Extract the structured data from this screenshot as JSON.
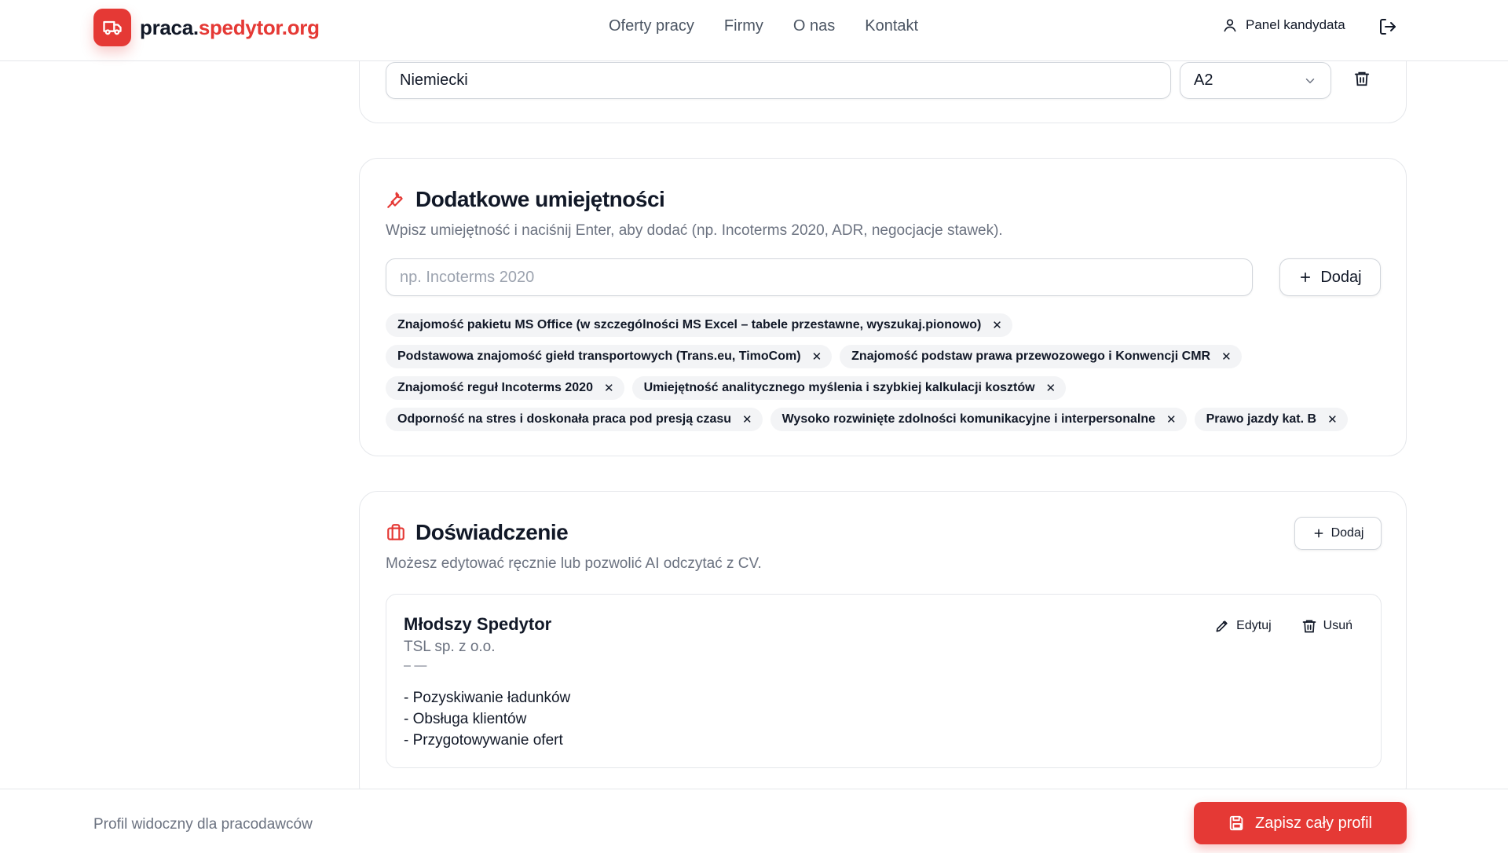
{
  "header": {
    "logo_text_a": "praca.",
    "logo_text_b": "spedytor.org",
    "nav": [
      "Oferty pracy",
      "Firmy",
      "O nas",
      "Kontakt"
    ],
    "panel_label": "Panel kandydata"
  },
  "languages": {
    "language_value": "Niemiecki",
    "level_value": "A2"
  },
  "skills": {
    "title": "Dodatkowe umiejętności",
    "description": "Wpisz umiejętność i naciśnij Enter, aby dodać (np. Incoterms 2020, ADR, negocjacje stawek).",
    "input_placeholder": "np. Incoterms 2020",
    "add_label": "Dodaj",
    "tags": [
      "Znajomość pakietu MS Office (w szczególności MS Excel – tabele przestawne, wyszukaj.pionowo)",
      "Podstawowa znajomość giełd transportowych (Trans.eu, TimoCom)",
      "Znajomość podstaw prawa przewozowego i Konwencji CMR",
      "Znajomość reguł Incoterms 2020",
      "Umiejętność analitycznego myślenia i szybkiej kalkulacji kosztów",
      "Odporność na stres i doskonała praca pod presją czasu",
      "Wysoko rozwinięte zdolności komunikacyjne i interpersonalne",
      "Prawo jazdy kat. B"
    ],
    "remove_glyph": "✕"
  },
  "experience": {
    "title": "Doświadczenie",
    "description": "Możesz edytować ręcznie lub pozwolić AI odczytać z CV.",
    "add_label": "Dodaj",
    "item": {
      "title": "Młodszy Spedytor",
      "company": "TSL sp. z o.o.",
      "dates": "– —",
      "lines": [
        "- Pozyskiwanie ładunków",
        "- Obsługa klientów",
        "- Przygotowywanie ofert"
      ],
      "edit_label": "Edytuj",
      "delete_label": "Usuń"
    }
  },
  "footer": {
    "visibility_text": "Profil widoczny dla pracodawców",
    "save_label": "Zapisz cały profil"
  },
  "colors": {
    "accent": "#e53935"
  }
}
